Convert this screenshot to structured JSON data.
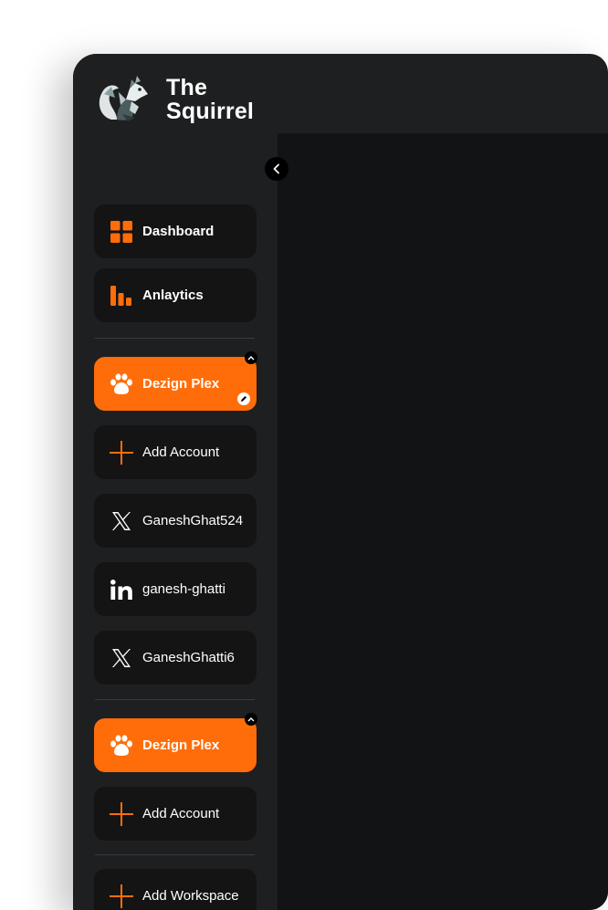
{
  "app": {
    "name_line1": "The",
    "name_line2": "Squirrel"
  },
  "colors": {
    "accent": "#ff6d0a",
    "sidebar_bg": "#1e1f21",
    "item_bg": "#141415",
    "main_bg": "#121314"
  },
  "nav": [
    {
      "label": "Dashboard",
      "icon": "grid-icon"
    },
    {
      "label": "Anlaytics",
      "icon": "bar-chart-icon"
    }
  ],
  "workspaces": [
    {
      "name": "Dezign Plex",
      "icon": "paw-icon",
      "add_account_label": "Add Account",
      "accounts": [
        {
          "label": "GaneshGhat524",
          "icon": "x-icon"
        },
        {
          "label": "ganesh-ghatti",
          "icon": "linkedin-icon"
        },
        {
          "label": "GaneshGhatti6",
          "icon": "x-icon"
        }
      ]
    },
    {
      "name": "Dezign Plex",
      "icon": "paw-icon",
      "add_account_label": "Add Account",
      "accounts": []
    }
  ],
  "add_workspace_label": "Add Workspace"
}
